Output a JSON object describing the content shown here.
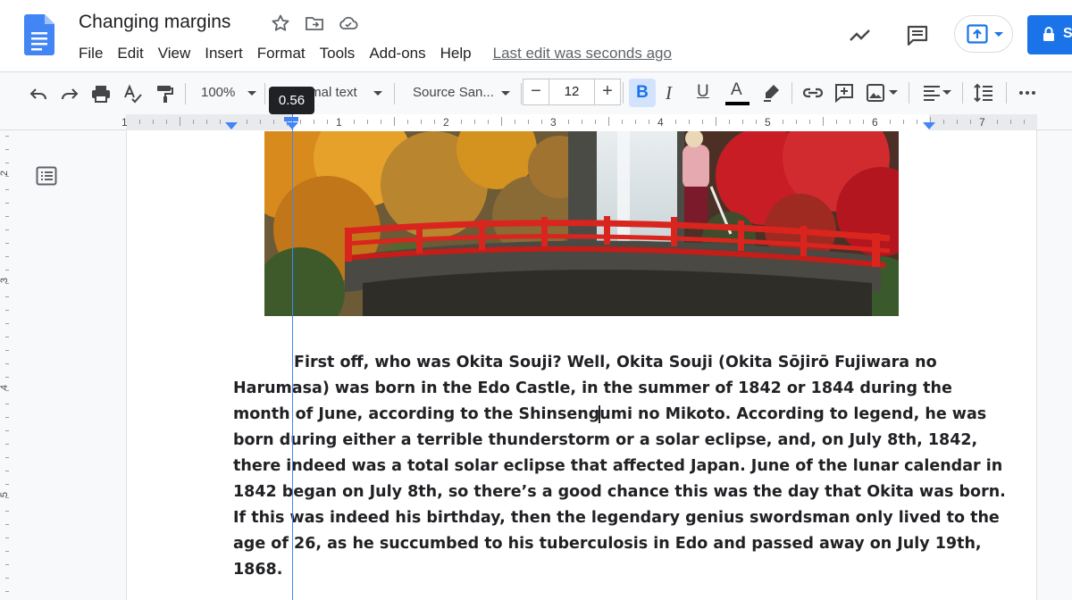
{
  "app": {
    "doc_title": "Changing margins",
    "menus": [
      "File",
      "Edit",
      "View",
      "Insert",
      "Format",
      "Tools",
      "Add-ons",
      "Help"
    ],
    "last_edit": "Last edit was seconds ago",
    "share_label": "S"
  },
  "toolbar": {
    "zoom": "100%",
    "style": "Normal text",
    "font": "Source San...",
    "font_size": "12",
    "minus": "−",
    "plus": "+",
    "bold": "B",
    "italic": "I",
    "underline": "U",
    "text_color": "A"
  },
  "ruler": {
    "numbers": [
      "1",
      "1",
      "2",
      "3",
      "4",
      "5",
      "6",
      "7"
    ],
    "tooltip": "0.56"
  },
  "vruler": {
    "numbers": [
      "2",
      "3",
      "4",
      "5"
    ]
  },
  "document": {
    "paragraph_lines": [
      "First off, who was Okita Souji? Well, Okita Souji (Okita Sōjirō Fujiwara no",
      "Harumasa) was born in the Edo Castle, in the summer of 1842 or 1844 during the",
      "month of June, according to the Shinsengumi no Mikoto. According to legend, he was",
      "born during either a terrible thunderstorm or a solar eclipse, and, on July 8th, 1842,",
      "there indeed was a total solar eclipse that affected Japan. June of the lunar calendar in",
      "1842 began on July 8th, so there’s a good chance this was the day that Okita was born.",
      "If this was indeed his birthday, then the legendary genius swordsman only lived to the",
      "age of 26, as he succumbed to his tuberculosis in Edo and passed away on July 19th,",
      "1868."
    ]
  },
  "colors": {
    "accent": "#1a73e8",
    "guide": "#4285f4",
    "bold_active_bg": "#d3e3fd"
  }
}
